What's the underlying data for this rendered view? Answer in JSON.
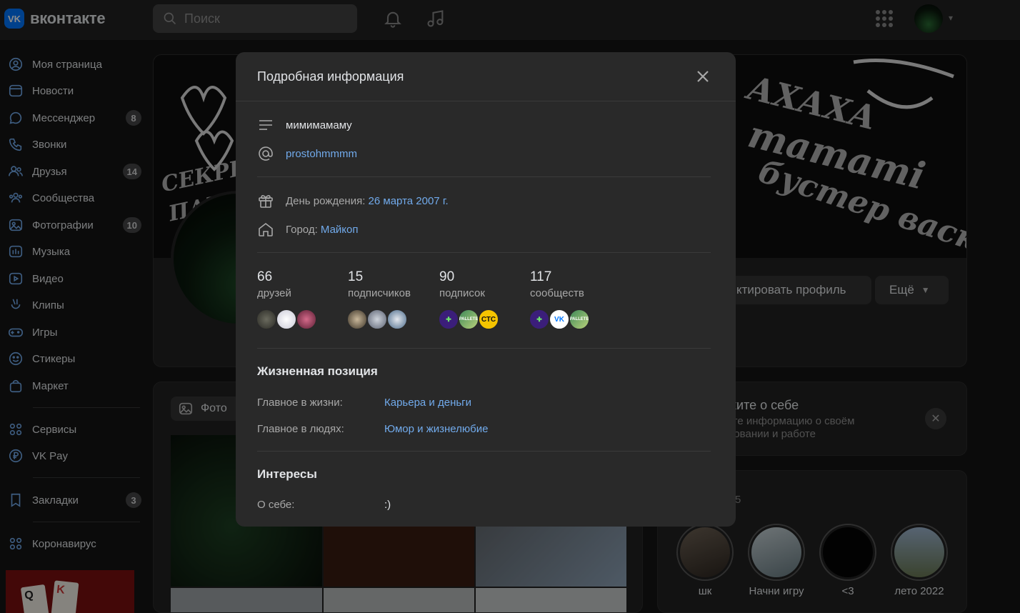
{
  "topbar": {
    "logo_mark": "VK",
    "logo_text": "вконтакте",
    "search_placeholder": "Поиск"
  },
  "sidebar": {
    "items": [
      {
        "label": "Моя страница",
        "icon": "user-circle-icon"
      },
      {
        "label": "Новости",
        "icon": "news-icon"
      },
      {
        "label": "Мессенджер",
        "icon": "message-icon",
        "count": "8"
      },
      {
        "label": "Звонки",
        "icon": "phone-icon"
      },
      {
        "label": "Друзья",
        "icon": "friends-icon",
        "count": "14"
      },
      {
        "label": "Сообщества",
        "icon": "communities-icon"
      },
      {
        "label": "Фотографии",
        "icon": "photo-icon",
        "count": "10"
      },
      {
        "label": "Музыка",
        "icon": "music-icon"
      },
      {
        "label": "Видео",
        "icon": "video-icon"
      },
      {
        "label": "Клипы",
        "icon": "clips-icon"
      },
      {
        "label": "Игры",
        "icon": "gamepad-icon"
      },
      {
        "label": "Стикеры",
        "icon": "smile-icon"
      },
      {
        "label": "Маркет",
        "icon": "bag-icon"
      },
      {
        "label": "Сервисы",
        "icon": "services-icon"
      },
      {
        "label": "VK Pay",
        "icon": "ruble-icon"
      },
      {
        "label": "Закладки",
        "icon": "bookmark-icon",
        "count": "3"
      },
      {
        "label": "Коронавирус",
        "icon": "services-icon"
      }
    ]
  },
  "profile": {
    "edit_button": "ктировать профиль",
    "more_button": "Ещё"
  },
  "photos": {
    "tab_label": "Фото"
  },
  "about_prompt": {
    "title": "жите о себе",
    "description": "ьте информацию о своём ровании и работе"
  },
  "stories": {
    "count": "5",
    "items": [
      {
        "label": "шк"
      },
      {
        "label": "Начни игру"
      },
      {
        "label": "<3"
      },
      {
        "label": "лето 2022"
      }
    ]
  },
  "modal": {
    "title": "Подробная информация",
    "status": "мимимамаму",
    "nickname": "prostohmmmm",
    "birthday_label": "День рождения:",
    "birthday_value": "26 марта 2007 г.",
    "city_label": "Город:",
    "city_value": "Майкоп",
    "stats": [
      {
        "number": "66",
        "label": "друзей"
      },
      {
        "number": "15",
        "label": "подписчиков"
      },
      {
        "number": "90",
        "label": "подписок"
      },
      {
        "number": "117",
        "label": "сообществ"
      }
    ],
    "community_badges": {
      "sts": "СТС",
      "vk": "VK",
      "pallete": "PALLETE"
    },
    "life_position": {
      "title": "Жизненная позиция",
      "main_in_life_label": "Главное в жизни:",
      "main_in_life_value": "Карьера и деньги",
      "main_in_people_label": "Главное в людях:",
      "main_in_people_value": "Юмор и жизнелюбие"
    },
    "interests": {
      "title": "Интересы",
      "about_label": "О себе:",
      "about_value": ":)"
    }
  },
  "colors": {
    "background": "#141414",
    "surface": "#222222",
    "modal": "#292929",
    "link": "#71aaeb",
    "brand": "#0077ff"
  }
}
